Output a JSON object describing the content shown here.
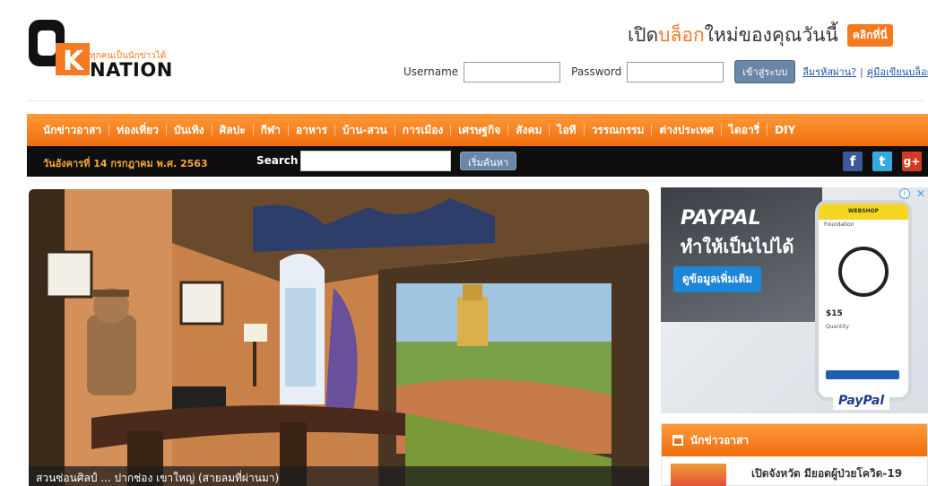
{
  "header": {
    "logo": {
      "tagline": "ทุกคนเป็นนักข่าวได้",
      "name": "NATION"
    },
    "promo": {
      "part1": "เปิด",
      "part2": "บล็อก",
      "part3": "ใหม่ของคุณวันนี้",
      "cta": "คลิกที่นี่"
    },
    "login": {
      "username_label": "Username",
      "password_label": "Password",
      "submit_label": "เข้าสู่ระบบ",
      "forgot_label": "ลืมรหัสผ่าน?",
      "separator": "|",
      "guide_label": "คู่มือเขียนบล็อก"
    }
  },
  "nav": {
    "items": [
      "นักข่าวอาสา",
      "ท่องเที่ยว",
      "บันเทิง",
      "ศิลปะ",
      "กีฬา",
      "อาหาร",
      "บ้าน-สวน",
      "การเมือง",
      "เศรษฐกิจ",
      "สังคม",
      "ไอที",
      "วรรณกรรม",
      "ต่างประเทศ",
      "ไดอารี่",
      "DIY"
    ]
  },
  "subbar": {
    "date": "วันอังคารที่ 14 กรกฎาคม พ.ศ. 2563",
    "search_label": "Search",
    "search_button": "เริ่มค้นหา",
    "social": {
      "facebook": "f",
      "twitter": "t",
      "google": "g+"
    }
  },
  "hero": {
    "caption": "สวนซ่อนศิลป์ ... ปากช่อง เขาใหญ่ (สายลมที่ผ่านมา)"
  },
  "ad": {
    "brand": "PAYPAL",
    "slogan": "ทำให้เป็นไปได้",
    "cta": "ดูข้อมูลเพิ่มเติม",
    "phone_header": "WEBSHOP",
    "phone_item": "Foundation",
    "phone_price": "$15",
    "phone_qty": "Quantity",
    "badge": "PayPal"
  },
  "news": {
    "title": "นักข่าวอาสา",
    "item_title": "เปิดจังหวัด มียอดผู้ป่วยโควิด-19"
  },
  "colors": {
    "orange": "#ef6d0c",
    "dark": "#0e0e0e",
    "link": "#2255aa"
  }
}
